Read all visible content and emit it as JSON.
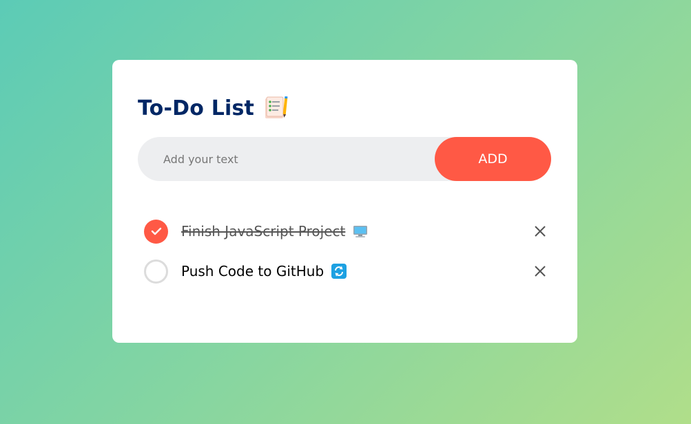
{
  "app": {
    "title": "To-Do List",
    "title_icon": "notepad-icon"
  },
  "input": {
    "placeholder": "Add your text",
    "value": ""
  },
  "add_button": {
    "label": "ADD"
  },
  "tasks": [
    {
      "text": "Finish JavaScript Project",
      "emoji_icon": "computer-icon",
      "checked": true
    },
    {
      "text": "Push Code to GitHub",
      "emoji_icon": "sync-icon",
      "checked": false
    }
  ],
  "colors": {
    "accent": "#ff5945",
    "title": "#002765",
    "input_bg": "#edeef0",
    "bg_gradient_start": "#5ccbb6",
    "bg_gradient_end": "#b0de8a"
  }
}
